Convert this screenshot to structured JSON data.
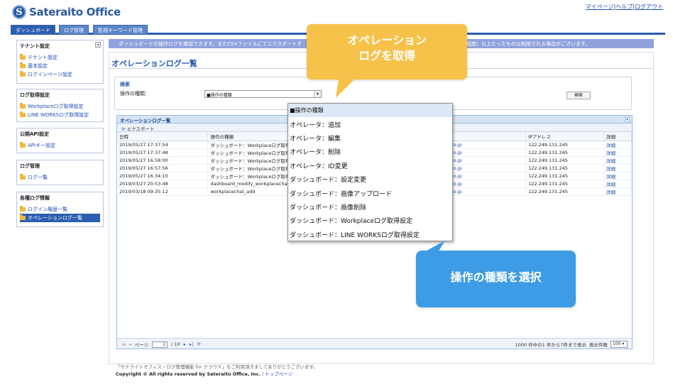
{
  "header": {
    "logo_mark": "S",
    "logo_text": "Sateraito Office",
    "links": [
      "マイページ",
      "ヘルプ",
      "ログアウト"
    ],
    "separator": "|"
  },
  "nav": {
    "tabs": [
      {
        "label": "ダッシュボード",
        "active": true
      },
      {
        "label": "ログ管理",
        "active": false
      },
      {
        "label": "監視キーワード管理",
        "active": false
      }
    ]
  },
  "sidebar": {
    "collapse_icon": "◂",
    "sections": [
      {
        "title": "テナント設定",
        "items": [
          "テナント設定",
          "基本設定",
          "ログインページ設定"
        ]
      },
      {
        "title": "ログ取得設定",
        "items": [
          "Workplaceログ取得設定",
          "LINE WORKSログ取得設定"
        ]
      },
      {
        "title": "公開API設定",
        "items": [
          "APIキー設定"
        ]
      },
      {
        "title": "ログ管理",
        "items": [
          "ログ一覧"
        ]
      },
      {
        "title": "各種ログ情報",
        "items": [
          "ログイン履歴一覧",
          "オペレーションログ一覧"
        ]
      }
    ]
  },
  "info_bar": {
    "text": "ダッシュボードの操作ログを確認できます。またCSVファイルにてエクスポートす",
    "text_right": "ヶ月程度）以上たったものは削除される場合がございます。"
  },
  "main": {
    "page_title": "オペレーションログ一覧",
    "search": {
      "title": "検索",
      "operation_label": "操作の種類：",
      "operation_value": "■操作の種類",
      "button": "検索"
    },
    "grid": {
      "title": "オペレーションログ一覧",
      "export_label": "エクスポート",
      "columns": [
        "日時",
        "操作の種類",
        "",
        "IPアドレス",
        "詳細"
      ],
      "rows": [
        {
          "datetime": "2019/05/27 17:37:54",
          "operation": "ダッシュボード：Workplaceログ取得",
          "user": "to.jp",
          "ip": "122.249.131.245",
          "detail": "詳細"
        },
        {
          "datetime": "2019/05/27 17:37:48",
          "operation": "ダッシュボード：Workplaceログ取得",
          "user": "to.jp",
          "ip": "122.249.131.245",
          "detail": "詳細"
        },
        {
          "datetime": "2019/05/27 16:58:00",
          "operation": "ダッシュボード：Workplaceログ取得",
          "user": "to.jp",
          "ip": "122.249.131.245",
          "detail": "詳細"
        },
        {
          "datetime": "2019/05/27 16:57:56",
          "operation": "ダッシュボード：Workplaceログ取得",
          "user": "to.jp",
          "ip": "122.249.131.245",
          "detail": "詳細"
        },
        {
          "datetime": "2019/05/27 16:34:10",
          "operation": "ダッシュボード：Workplaceログ取得",
          "user": "to.jp",
          "ip": "122.249.131.245",
          "detail": "詳細"
        },
        {
          "datetime": "2019/03/27 20:53:48",
          "operation": "dashboard_modify_workplacechat",
          "user": "to.jp",
          "ip": "122.249.131.245",
          "detail": "詳細"
        },
        {
          "datetime": "2019/03/18 09:35:12",
          "operation": "workplacechat_add",
          "user": "to.jp",
          "ip": "122.249.131.245",
          "detail": "詳細"
        }
      ],
      "pager": {
        "page_label": "ページ",
        "page_value": "1",
        "page_total": "/ 10",
        "summary": "1000 件中の1 件から7件まで表示",
        "size_label": "表示件数",
        "size_value": "100"
      }
    }
  },
  "dropdown": {
    "options": [
      "■操作の種類",
      "オペレータ：追加",
      "オペレータ：編集",
      "オペレータ：削除",
      "オペレータ：ID変更",
      "ダッシュボード：設定変更",
      "ダッシュボード：画像アップロード",
      "ダッシュボード：画像削除",
      "ダッシュボード：Workplaceログ取得設定",
      "ダッシュボード：LINE WORKSログ取得設定"
    ]
  },
  "callouts": {
    "yellow_line1": "オペレーション",
    "yellow_line2": "ログを取得",
    "blue": "操作の種類を選択"
  },
  "footer": {
    "line1": "「サテライトオフィス・ログ管理機能 for クラウド」をご利用頂きましてありがとうございます。",
    "copyright": "Copyright © All rights reserved by Sateraito Office, Inc.",
    "separator": "|",
    "top_link": "トップページ"
  },
  "colors": {
    "brand_blue": "#2b5db0",
    "callout_yellow": "#f6c24a",
    "callout_blue": "#3d9ce5"
  }
}
